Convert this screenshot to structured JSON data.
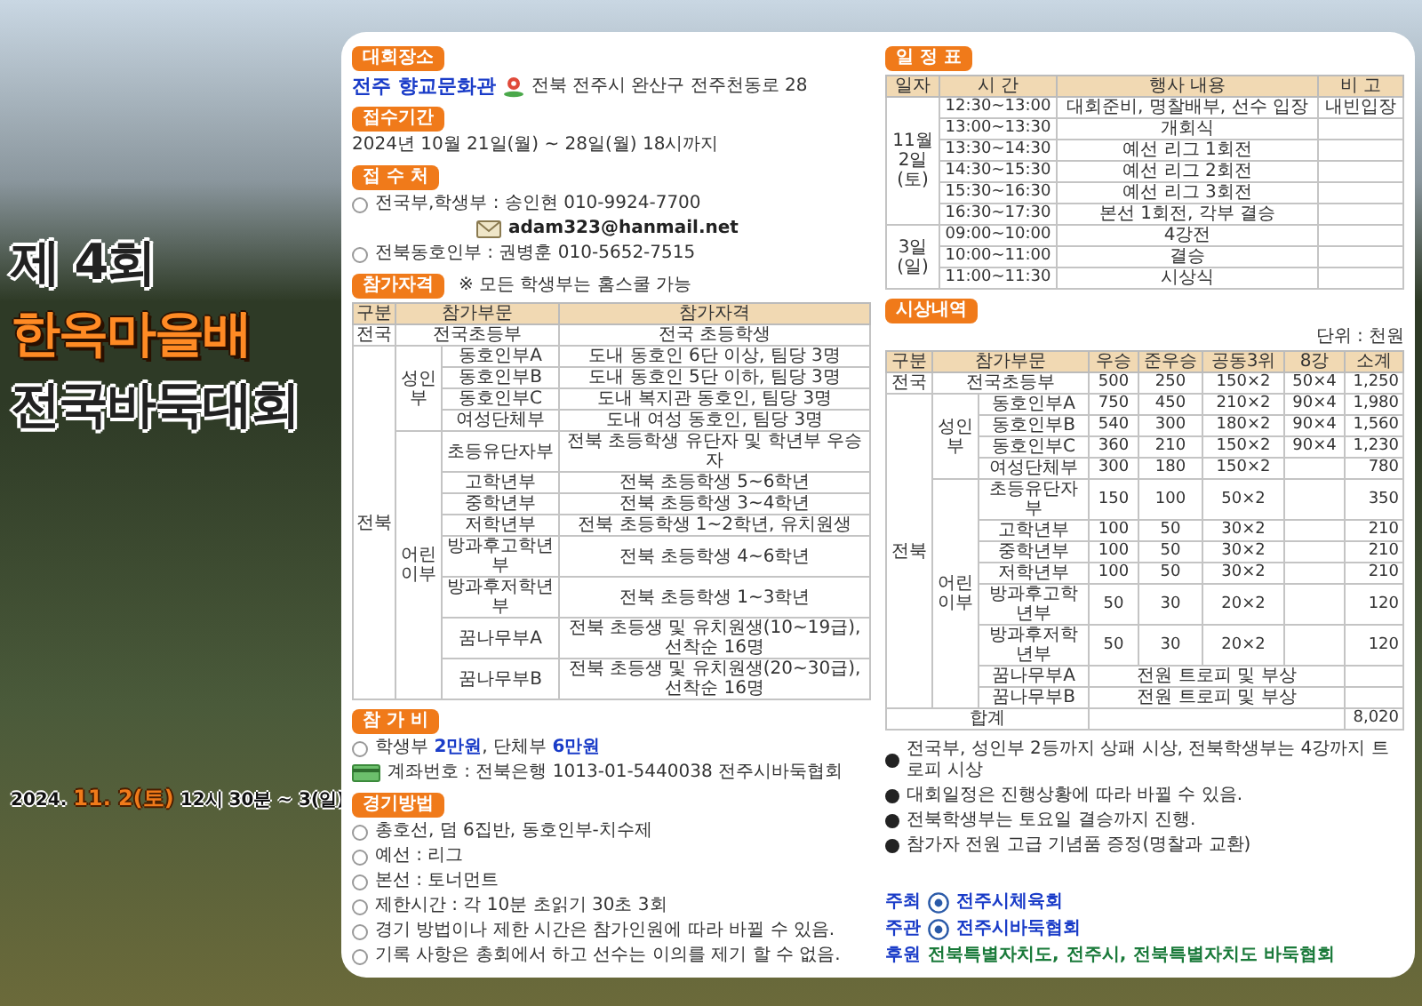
{
  "poster": {
    "title_lines": [
      {
        "text": "제 4회",
        "kind": "plain"
      },
      {
        "text": "한옥마을배",
        "kind": "accent"
      },
      {
        "text": "전국바둑대회",
        "kind": "plain"
      }
    ],
    "date": "2024. **11. 2(토)** 12시 30분 ~ 3(일)"
  },
  "venue": {
    "heading": "대회장소",
    "name": "전주 향교문화관",
    "address": "전북 전주시 완산구 전주천동로 28"
  },
  "registration_period": {
    "heading": "접수기간",
    "text": "2024년 10월 21일(월) ~ 28일(월) 18시까지"
  },
  "registration_contacts": {
    "heading": "접 수 처",
    "items": [
      {
        "kind": "bullet",
        "text": "전국부,학생부 : 송인현 010-9924-7700"
      },
      {
        "kind": "email",
        "text": "adam323@hanmail.net"
      },
      {
        "kind": "bullet",
        "text": "전북동호인부 : 권병훈 010-5652-7515"
      }
    ]
  },
  "eligibility": {
    "heading": "참가자격",
    "note": "※ 모든 학생부는 홈스쿨 가능",
    "columns": [
      "구분",
      "참가부문",
      "참가자격"
    ],
    "regions": [
      {
        "name": "전국",
        "divisions": [
          {
            "name": "전국초등부",
            "qualification": "전국 초등학생"
          }
        ]
      },
      {
        "name": "전북",
        "categories": [
          {
            "name": "성인부",
            "divisions": [
              {
                "name": "동호인부A",
                "qualification": "도내 동호인 6단 이상, 팀당 3명"
              },
              {
                "name": "동호인부B",
                "qualification": "도내 동호인 5단 이하, 팀당 3명"
              },
              {
                "name": "동호인부C",
                "qualification": "도내 복지관 동호인, 팀당 3명"
              },
              {
                "name": "여성단체부",
                "qualification": "도내 여성 동호인, 팀당 3명"
              }
            ]
          },
          {
            "name": "어린이부",
            "divisions": [
              {
                "name": "초등유단자부",
                "qualification": "전북 초등학생 유단자 및 학년부 우승자"
              },
              {
                "name": "고학년부",
                "qualification": "전북 초등학생 5~6학년"
              },
              {
                "name": "중학년부",
                "qualification": "전북 초등학생 3~4학년"
              },
              {
                "name": "저학년부",
                "qualification": "전북 초등학생 1~2학년, 유치원생"
              },
              {
                "name": "방과후고학년부",
                "qualification": "전북 초등학생 4~6학년"
              },
              {
                "name": "방과후저학년부",
                "qualification": "전북 초등학생 1~3학년"
              },
              {
                "name": "꿈나무부A",
                "qualification": "전북 초등생 및 유치원생(10~19급),선착순 16명"
              },
              {
                "name": "꿈나무부B",
                "qualification": "전북 초등생 및 유치원생(20~30급),선착순 16명"
              }
            ]
          }
        ]
      }
    ]
  },
  "fee": {
    "heading": "참 가 비",
    "items": [
      {
        "kind": "bullet",
        "text": "학생부 **2만원**, 단체부 **6만원**"
      },
      {
        "kind": "account",
        "text": "계좌번호 : 전북은행 1013-01-5440038 전주시바둑협회"
      }
    ]
  },
  "match_rules": {
    "heading": "경기방법",
    "items": [
      "총호선, 덤 6집반, 동호인부-치수제",
      "예선 : 리그",
      "본선 : 토너먼트",
      "제한시간 : 각 10분 초읽기 30초 3회",
      "경기 방법이나 제한 시간은 참가인원에 따라 바뀔 수 있음.",
      "기록 사항은 총회에서 하고 선수는 이의를 제기 할 수 없음."
    ]
  },
  "schedule": {
    "heading": "일 정 표",
    "columns": [
      "일자",
      "시 간",
      "행사 내용",
      "비 고"
    ],
    "days": [
      {
        "date": "11월 2일 (토)",
        "items": [
          {
            "time": "12:30~13:00",
            "event": "대회준비, 명찰배부, 선수 입장",
            "remark": "내빈입장"
          },
          {
            "time": "13:00~13:30",
            "event": "개회식"
          },
          {
            "time": "13:30~14:30",
            "event": "예선 리그 1회전"
          },
          {
            "time": "14:30~15:30",
            "event": "예선 리그 2회전"
          },
          {
            "time": "15:30~16:30",
            "event": "예선 리그 3회전"
          },
          {
            "time": "16:30~17:30",
            "event": "본선 1회전, 각부 결승"
          }
        ]
      },
      {
        "date": "3일 (일)",
        "items": [
          {
            "time": "09:00~10:00",
            "event": "4강전"
          },
          {
            "time": "10:00~11:00",
            "event": "결승"
          },
          {
            "time": "11:00~11:30",
            "event": "시상식"
          }
        ]
      }
    ]
  },
  "prizes": {
    "heading": "시상내역",
    "unit": "단위 : 천원",
    "columns": [
      "구분",
      "참가부문",
      "우승",
      "준우승",
      "공동3위",
      "8강",
      "소계"
    ],
    "regions": [
      {
        "name": "전국",
        "divisions": [
          {
            "name": "전국초등부",
            "values": [
              "500",
              "250",
              "150×2",
              "50×4"
            ],
            "subtotal": "1,250"
          }
        ]
      },
      {
        "name": "전북",
        "categories": [
          {
            "name": "성인부",
            "divisions": [
              {
                "name": "동호인부A",
                "values": [
                  "750",
                  "450",
                  "210×2",
                  "90×4"
                ],
                "subtotal": "1,980"
              },
              {
                "name": "동호인부B",
                "values": [
                  "540",
                  "300",
                  "180×2",
                  "90×4"
                ],
                "subtotal": "1,560"
              },
              {
                "name": "동호인부C",
                "values": [
                  "360",
                  "210",
                  "150×2",
                  "90×4"
                ],
                "subtotal": "1,230"
              },
              {
                "name": "여성단체부",
                "values": [
                  "300",
                  "180",
                  "150×2"
                ],
                "subtotal": "780"
              }
            ]
          },
          {
            "name": "어린이부",
            "divisions": [
              {
                "name": "초등유단자부",
                "values": [
                  "150",
                  "100",
                  "50×2"
                ],
                "subtotal": "350"
              },
              {
                "name": "고학년부",
                "values": [
                  "100",
                  "50",
                  "30×2"
                ],
                "subtotal": "210"
              },
              {
                "name": "중학년부",
                "values": [
                  "100",
                  "50",
                  "30×2"
                ],
                "subtotal": "210"
              },
              {
                "name": "저학년부",
                "values": [
                  "100",
                  "50",
                  "30×2"
                ],
                "subtotal": "210"
              },
              {
                "name": "방과후고학년부",
                "values": [
                  "50",
                  "30",
                  "20×2"
                ],
                "subtotal": "120"
              },
              {
                "name": "방과후저학년부",
                "values": [
                  "50",
                  "30",
                  "20×2"
                ],
                "subtotal": "120"
              },
              {
                "name": "꿈나무부A",
                "note": "전원 트로피 및 부상"
              },
              {
                "name": "꿈나무부B",
                "note": "전원 트로피 및 부상"
              }
            ]
          }
        ]
      }
    ],
    "total": {
      "label": "합계",
      "value": "8,020"
    }
  },
  "notes": [
    "전국부, 성인부 2등까지 상패 시상, 전북학생부는 4강까지 트로피 시상",
    "대회일정은 진행상황에 따라 바뀔 수 있음.",
    "전북학생부는 토요일 결승까지 진행.",
    "참가자 전원 고급 기념품 증정(명찰과 교환)"
  ],
  "organizers": [
    {
      "role": "주최",
      "kind": "emblem",
      "names": [
        "전주시체육회"
      ]
    },
    {
      "role": "주관",
      "kind": "emblem",
      "names": [
        "전주시바둑협회"
      ]
    },
    {
      "role": "후원",
      "kind": "plain",
      "names": [
        "전북특별자치도,",
        "전주시,",
        "전북특별자치도 바둑협회"
      ]
    }
  ]
}
